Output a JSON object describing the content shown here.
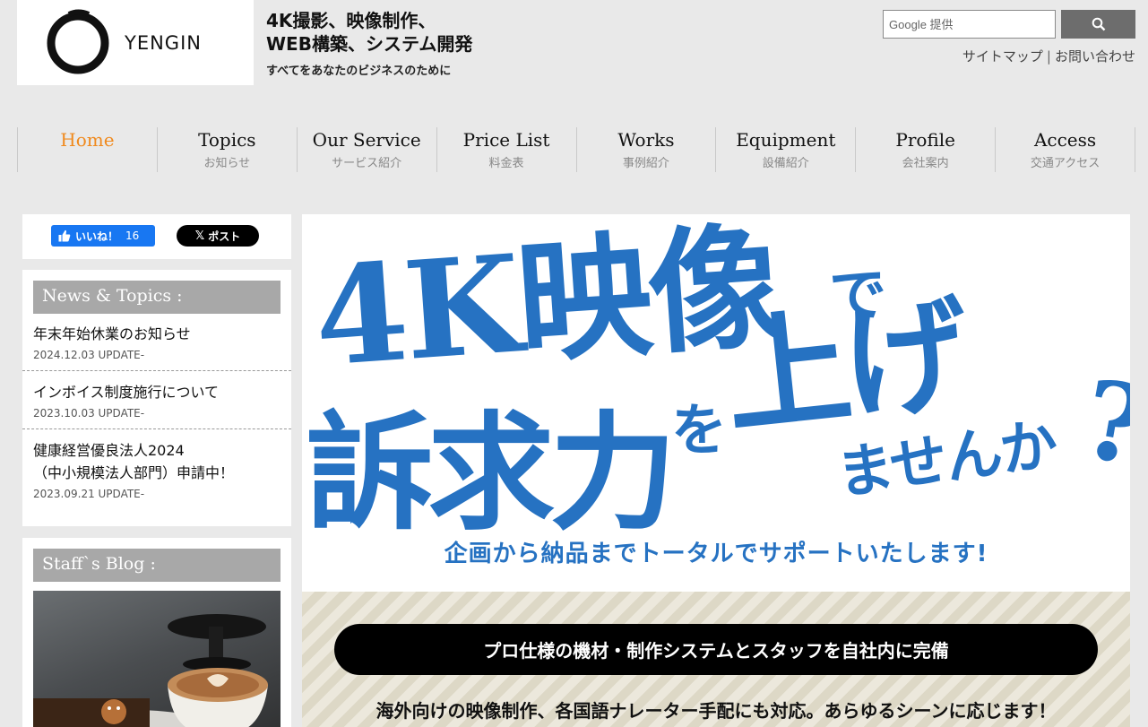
{
  "header": {
    "logo_text": "YENGIN",
    "tagline_line1": "4K撮影、映像制作、",
    "tagline_line2": "WEB構築、システム開発",
    "tagline_line3": "すべてをあなたのビジネスのために",
    "search_placeholder": "Google 提供",
    "sitemap_label": "サイトマップ",
    "separator": "|",
    "contact_label": "お問い合わせ"
  },
  "nav": {
    "items": [
      {
        "en": "Home",
        "jp": ""
      },
      {
        "en": "Topics",
        "jp": "お知らせ"
      },
      {
        "en": "Our Service",
        "jp": "サービス紹介"
      },
      {
        "en": "Price List",
        "jp": "料金表"
      },
      {
        "en": "Works",
        "jp": "事例紹介"
      },
      {
        "en": "Equipment",
        "jp": "設備紹介"
      },
      {
        "en": "Profile",
        "jp": "会社案内"
      },
      {
        "en": "Access",
        "jp": "交通アクセス"
      }
    ]
  },
  "social": {
    "like_label": "いいね！",
    "like_count": "16",
    "post_label": "ポスト"
  },
  "news": {
    "heading": "News & Topics :",
    "items": [
      {
        "title": "年末年始休業のお知らせ",
        "date": "2024.12.03 UPDATE-"
      },
      {
        "title": "インボイス制度施行について",
        "date": "2023.10.03 UPDATE-"
      },
      {
        "title_line1": "健康経営優良法人2024",
        "title_line2": "（中小規模法人部門）申請中！",
        "date": "2023.09.21 UPDATE-"
      }
    ]
  },
  "blog": {
    "heading": "Staff`s Blog :"
  },
  "hero": {
    "line1": "4K映像",
    "de": "で",
    "line2": "訴求力",
    "wo": "を",
    "age": "上げ",
    "line3": "ませんか",
    "qmark": "?",
    "sub": "企画から納品までトータルでサポートいたします!"
  },
  "band": {
    "pill_text": "プロ仕様の機材・制作システムとスタッフを自社内に完備",
    "text": "海外向けの映像制作、各国語ナレーター手配にも対応。あらゆるシーンに応じます！"
  },
  "colors": {
    "accent_orange": "#f08a1e",
    "hero_blue": "#2672c2",
    "facebook_blue": "#1877f2"
  }
}
